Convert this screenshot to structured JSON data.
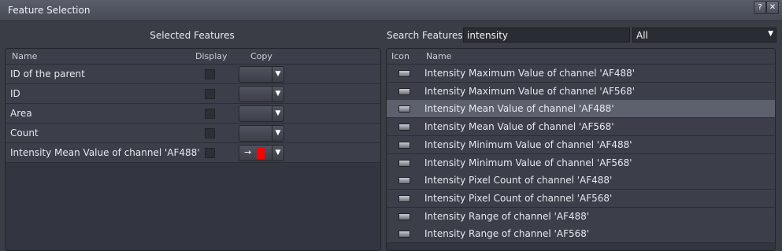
{
  "window": {
    "title": "Feature Selection",
    "help_label": "?",
    "close_label": "✕"
  },
  "selected": {
    "header": "Selected Features",
    "columns": {
      "name": "Name",
      "display": "Display",
      "copy": "Copy"
    },
    "rows": [
      {
        "name": "ID of the parent",
        "display": false,
        "copy": ""
      },
      {
        "name": "ID",
        "display": false,
        "copy": ""
      },
      {
        "name": "Area",
        "display": false,
        "copy": ""
      },
      {
        "name": "Count",
        "display": false,
        "copy": ""
      },
      {
        "name": "Intensity Mean Value of channel 'AF488'",
        "display": false,
        "copy": "→",
        "copy_color": "#ff0000"
      }
    ]
  },
  "search": {
    "label": "Search Features",
    "value": "intensity",
    "filter_value": "All"
  },
  "results": {
    "columns": {
      "icon": "Icon",
      "name": "Name"
    },
    "icon_name": "feature-icon",
    "selected_index": 2,
    "items": [
      "Intensity Maximum Value of channel 'AF488'",
      "Intensity Maximum Value of channel 'AF568'",
      "Intensity Mean Value of channel 'AF488'",
      "Intensity Mean Value of channel 'AF568'",
      "Intensity Minimum Value of channel 'AF488'",
      "Intensity Minimum Value of channel 'AF568'",
      "Intensity Pixel Count of channel 'AF488'",
      "Intensity Pixel Count of channel 'AF568'",
      "Intensity Range of channel 'AF488'",
      "Intensity Range of channel 'AF568'"
    ]
  }
}
